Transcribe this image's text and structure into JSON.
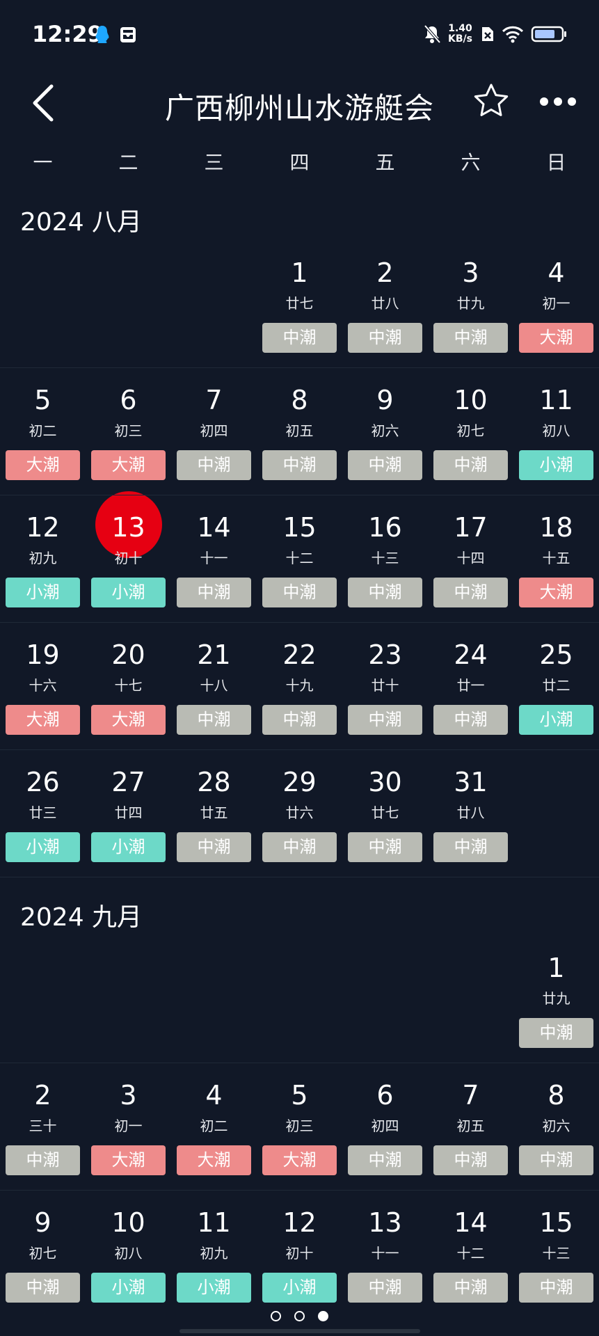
{
  "status": {
    "time": "12:29",
    "speed_top": "1.40",
    "speed_bottom": "KB/s"
  },
  "header": {
    "title": "广西柳州山水游艇会"
  },
  "weekdays": [
    "一",
    "二",
    "三",
    "四",
    "五",
    "六",
    "日"
  ],
  "colors": {
    "big": "#ee8b8b",
    "mid": "#b9bbb4",
    "small": "#6dd9c8",
    "today": "#e60012"
  },
  "months": [
    {
      "label": "2024 八月",
      "weeks": [
        [
          null,
          null,
          null,
          {
            "day": "1",
            "lunar": "廿七",
            "tide": "中潮",
            "level": "mid"
          },
          {
            "day": "2",
            "lunar": "廿八",
            "tide": "中潮",
            "level": "mid"
          },
          {
            "day": "3",
            "lunar": "廿九",
            "tide": "中潮",
            "level": "mid"
          },
          {
            "day": "4",
            "lunar": "初一",
            "tide": "大潮",
            "level": "big"
          }
        ],
        [
          {
            "day": "5",
            "lunar": "初二",
            "tide": "大潮",
            "level": "big"
          },
          {
            "day": "6",
            "lunar": "初三",
            "tide": "大潮",
            "level": "big"
          },
          {
            "day": "7",
            "lunar": "初四",
            "tide": "中潮",
            "level": "mid"
          },
          {
            "day": "8",
            "lunar": "初五",
            "tide": "中潮",
            "level": "mid"
          },
          {
            "day": "9",
            "lunar": "初六",
            "tide": "中潮",
            "level": "mid"
          },
          {
            "day": "10",
            "lunar": "初七",
            "tide": "中潮",
            "level": "mid"
          },
          {
            "day": "11",
            "lunar": "初八",
            "tide": "小潮",
            "level": "small"
          }
        ],
        [
          {
            "day": "12",
            "lunar": "初九",
            "tide": "小潮",
            "level": "small"
          },
          {
            "day": "13",
            "lunar": "初十",
            "tide": "小潮",
            "level": "small",
            "today": true
          },
          {
            "day": "14",
            "lunar": "十一",
            "tide": "中潮",
            "level": "mid"
          },
          {
            "day": "15",
            "lunar": "十二",
            "tide": "中潮",
            "level": "mid"
          },
          {
            "day": "16",
            "lunar": "十三",
            "tide": "中潮",
            "level": "mid"
          },
          {
            "day": "17",
            "lunar": "十四",
            "tide": "中潮",
            "level": "mid"
          },
          {
            "day": "18",
            "lunar": "十五",
            "tide": "大潮",
            "level": "big"
          }
        ],
        [
          {
            "day": "19",
            "lunar": "十六",
            "tide": "大潮",
            "level": "big"
          },
          {
            "day": "20",
            "lunar": "十七",
            "tide": "大潮",
            "level": "big"
          },
          {
            "day": "21",
            "lunar": "十八",
            "tide": "中潮",
            "level": "mid"
          },
          {
            "day": "22",
            "lunar": "十九",
            "tide": "中潮",
            "level": "mid"
          },
          {
            "day": "23",
            "lunar": "廿十",
            "tide": "中潮",
            "level": "mid"
          },
          {
            "day": "24",
            "lunar": "廿一",
            "tide": "中潮",
            "level": "mid"
          },
          {
            "day": "25",
            "lunar": "廿二",
            "tide": "小潮",
            "level": "small"
          }
        ],
        [
          {
            "day": "26",
            "lunar": "廿三",
            "tide": "小潮",
            "level": "small"
          },
          {
            "day": "27",
            "lunar": "廿四",
            "tide": "小潮",
            "level": "small"
          },
          {
            "day": "28",
            "lunar": "廿五",
            "tide": "中潮",
            "level": "mid"
          },
          {
            "day": "29",
            "lunar": "廿六",
            "tide": "中潮",
            "level": "mid"
          },
          {
            "day": "30",
            "lunar": "廿七",
            "tide": "中潮",
            "level": "mid"
          },
          {
            "day": "31",
            "lunar": "廿八",
            "tide": "中潮",
            "level": "mid"
          },
          null
        ]
      ]
    },
    {
      "label": "2024 九月",
      "weeks": [
        [
          null,
          null,
          null,
          null,
          null,
          null,
          {
            "day": "1",
            "lunar": "廿九",
            "tide": "中潮",
            "level": "mid"
          }
        ],
        [
          {
            "day": "2",
            "lunar": "三十",
            "tide": "中潮",
            "level": "mid"
          },
          {
            "day": "3",
            "lunar": "初一",
            "tide": "大潮",
            "level": "big"
          },
          {
            "day": "4",
            "lunar": "初二",
            "tide": "大潮",
            "level": "big"
          },
          {
            "day": "5",
            "lunar": "初三",
            "tide": "大潮",
            "level": "big"
          },
          {
            "day": "6",
            "lunar": "初四",
            "tide": "中潮",
            "level": "mid"
          },
          {
            "day": "7",
            "lunar": "初五",
            "tide": "中潮",
            "level": "mid"
          },
          {
            "day": "8",
            "lunar": "初六",
            "tide": "中潮",
            "level": "mid"
          }
        ],
        [
          {
            "day": "9",
            "lunar": "初七",
            "tide": "中潮",
            "level": "mid"
          },
          {
            "day": "10",
            "lunar": "初八",
            "tide": "小潮",
            "level": "small"
          },
          {
            "day": "11",
            "lunar": "初九",
            "tide": "小潮",
            "level": "small"
          },
          {
            "day": "12",
            "lunar": "初十",
            "tide": "小潮",
            "level": "small"
          },
          {
            "day": "13",
            "lunar": "十一",
            "tide": "中潮",
            "level": "mid"
          },
          {
            "day": "14",
            "lunar": "十二",
            "tide": "中潮",
            "level": "mid"
          },
          {
            "day": "15",
            "lunar": "十三",
            "tide": "中潮",
            "level": "mid"
          }
        ]
      ]
    }
  ],
  "pager": {
    "count": 3,
    "active": 2
  }
}
